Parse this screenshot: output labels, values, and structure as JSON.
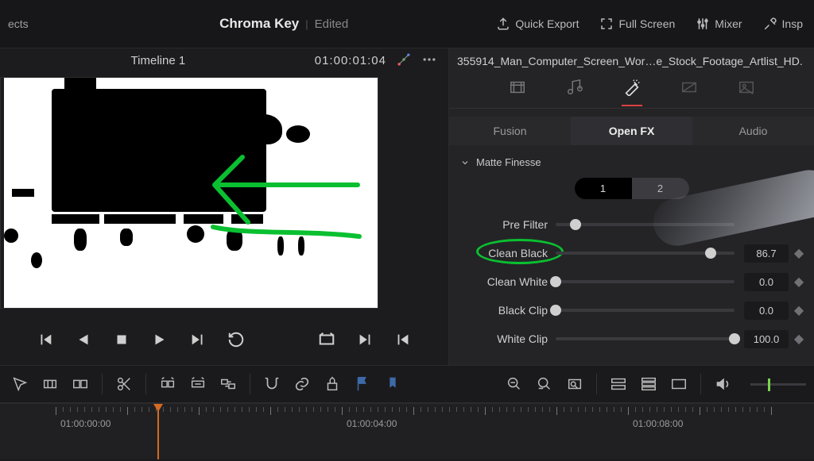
{
  "topbar": {
    "effects_stub": "ects",
    "title": "Chroma Key",
    "status": "Edited",
    "quick_export": "Quick Export",
    "full_screen": "Full Screen",
    "mixer": "Mixer",
    "inspector": "Insp"
  },
  "left": {
    "timeline_title": "Timeline 1",
    "timecode": "01:00:01:04"
  },
  "right": {
    "clip_name": "355914_Man_Computer_Screen_Wor…e_Stock_Footage_Artlist_HD.",
    "fx_tabs": {
      "fusion": "Fusion",
      "openfx": "Open FX",
      "audio": "Audio"
    },
    "section": "Matte Finesse",
    "segments": {
      "one": "1",
      "two": "2"
    },
    "sliders": [
      {
        "label": "Pre Filter",
        "value": "",
        "pos": 11,
        "showval": false
      },
      {
        "label": "Clean Black",
        "value": "86.7",
        "pos": 86.7,
        "showval": true
      },
      {
        "label": "Clean White",
        "value": "0.0",
        "pos": 0,
        "showval": true
      },
      {
        "label": "Black Clip",
        "value": "0.0",
        "pos": 0,
        "showval": true
      },
      {
        "label": "White Clip",
        "value": "100.0",
        "pos": 100,
        "showval": true
      }
    ]
  },
  "timeline": {
    "labels": [
      "01:00:00:00",
      "01:00:04:00",
      "01:00:08:00"
    ],
    "playhead_pct": 12
  }
}
